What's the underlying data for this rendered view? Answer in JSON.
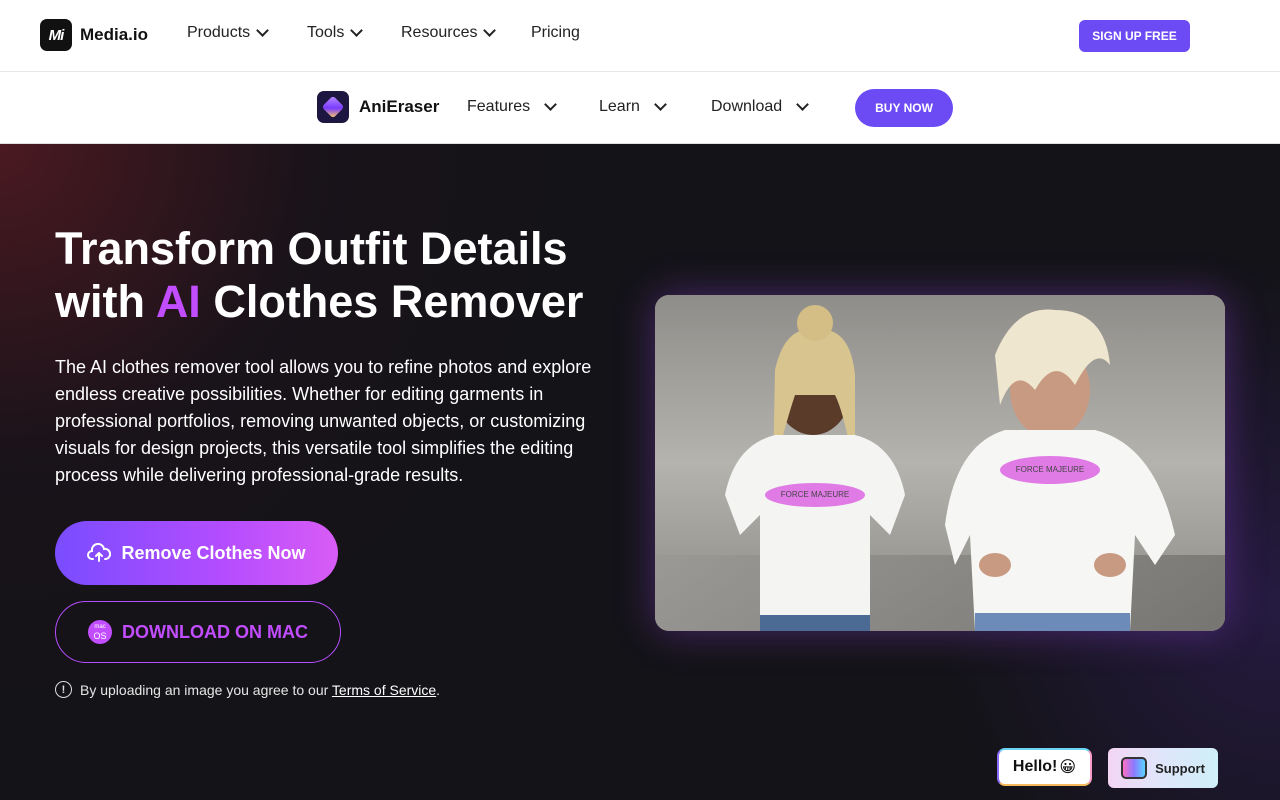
{
  "topnav": {
    "brand": "Media.io",
    "brand_logo": "Mi",
    "items": [
      "Products",
      "Tools",
      "Resources",
      "Pricing"
    ],
    "signup_label": "SIGN UP FREE"
  },
  "subnav": {
    "product": "AniEraser",
    "items": [
      "Features",
      "Learn",
      "Download"
    ],
    "buy_label": "BUY NOW"
  },
  "hero": {
    "title_line1": "Transform Outfit Details",
    "title_line2_pre": "with ",
    "title_accent": "AI",
    "title_line2_post": " Clothes Remover",
    "description": "The AI clothes remover tool allows you to refine photos and explore endless creative possibilities. Whether for editing garments in professional portfolios, removing unwanted objects, or customizing visuals for design projects, this versatile tool simplifies the editing process while delivering professional-grade results.",
    "primary_button": "Remove Clothes Now",
    "secondary_button": "DOWNLOAD ON MAC",
    "mac_badge_top": "mac",
    "mac_badge_bottom": "OS",
    "terms_prefix": "By uploading an image you agree to our ",
    "terms_link": "Terms of Service",
    "terms_suffix": "."
  },
  "photo": {
    "shirt_text": "FORCE MAJEURE"
  },
  "widgets": {
    "hello": "Hello!",
    "hello_emoji": "😀",
    "support": "Support"
  },
  "colors": {
    "accent": "#6c4bf5",
    "title_accent": "#c24dff",
    "background": "#141318"
  }
}
